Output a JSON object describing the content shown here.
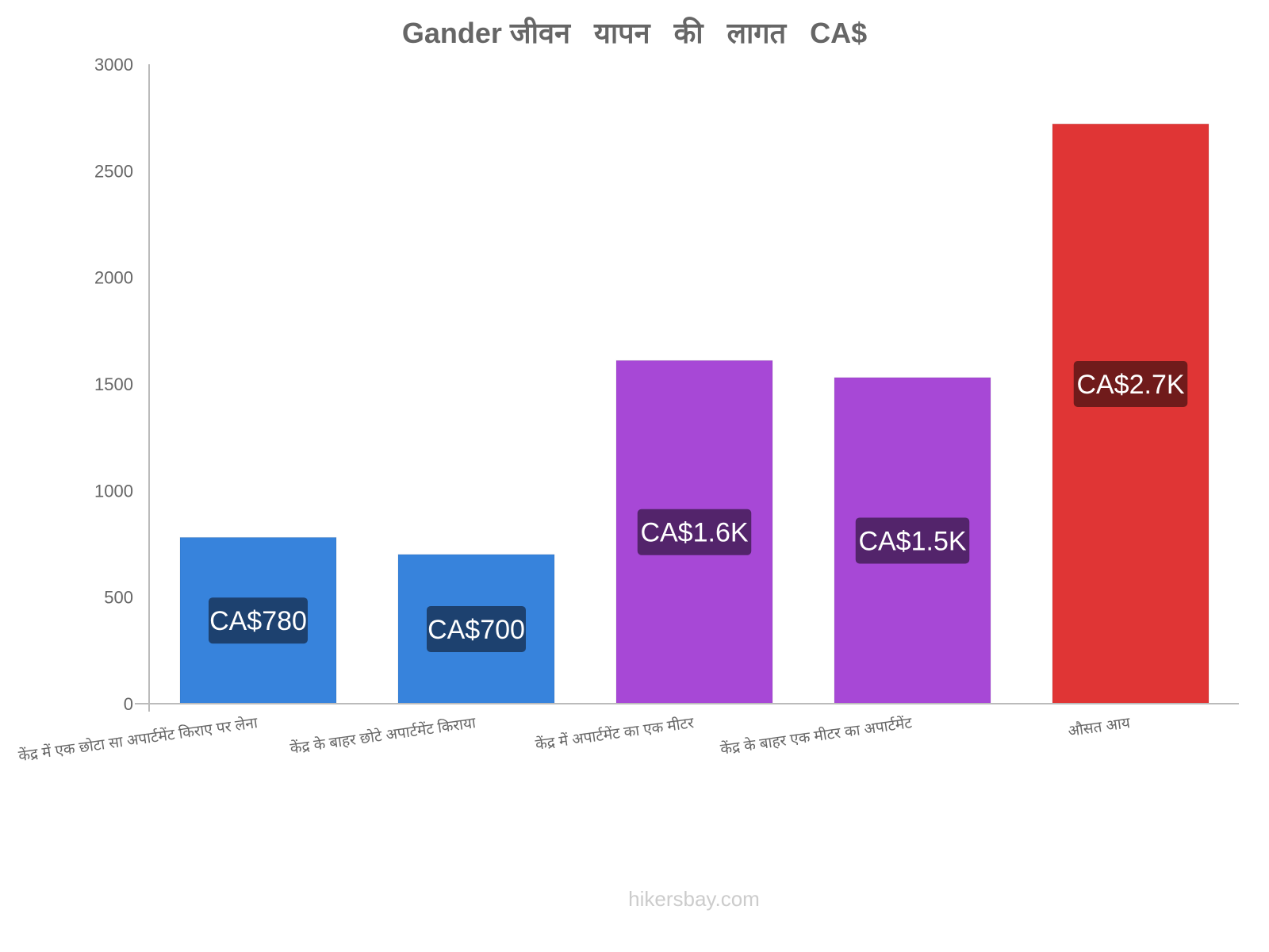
{
  "chart_data": {
    "type": "bar",
    "title": "Gander जीवन   यापन   की   लागत   CA$",
    "xlabel": "",
    "ylabel": "",
    "ylim": [
      0,
      3000
    ],
    "yticks": [
      0,
      500,
      1000,
      1500,
      2000,
      2500,
      3000
    ],
    "grid": false,
    "legend": "none",
    "categories": [
      "केंद्र में एक छोटा सा अपार्टमेंट किराए पर लेना",
      "केंद्र के बाहर छोटे अपार्टमेंट किराया",
      "केंद्र में अपार्टमेंट का एक मीटर",
      "केंद्र के बाहर एक मीटर का अपार्टमेंट",
      "औसत आय"
    ],
    "values": [
      780,
      700,
      1610,
      1530,
      2720
    ],
    "data_labels": [
      "CA$780",
      "CA$700",
      "CA$1.6K",
      "CA$1.5K",
      "CA$2.7K"
    ],
    "colors": [
      "#3783dc",
      "#3783dc",
      "#a748d6",
      "#a748d6",
      "#e03535"
    ],
    "label_bg_colors": [
      "#1d416f",
      "#1d416f",
      "#53246b",
      "#53246b",
      "#701b1b"
    ]
  },
  "watermark": "hikersbay.com"
}
